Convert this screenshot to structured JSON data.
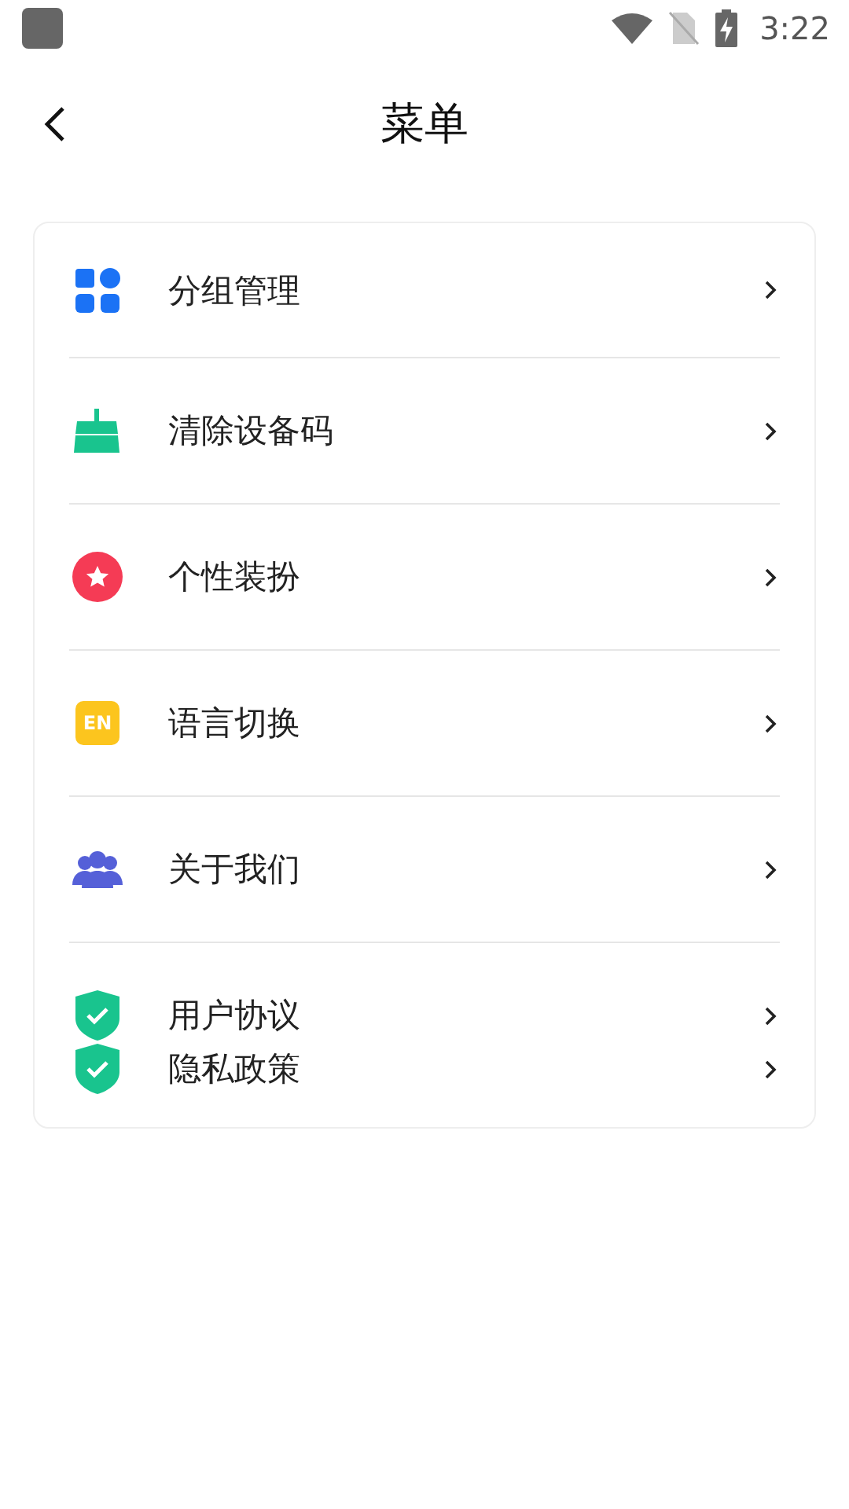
{
  "status_bar": {
    "time": "3:22"
  },
  "header": {
    "title": "菜单"
  },
  "menu": {
    "items": [
      {
        "kind": "grid",
        "label": "分组管理"
      },
      {
        "kind": "broom",
        "label": "清除设备码"
      },
      {
        "kind": "star",
        "label": "个性装扮"
      },
      {
        "kind": "lang",
        "label": "语言切换",
        "badge": "EN"
      },
      {
        "kind": "people",
        "label": "关于我们"
      }
    ],
    "compact_items": [
      {
        "kind": "shield",
        "label": "用户协议"
      },
      {
        "kind": "shield",
        "label": "隐私政策"
      }
    ]
  }
}
